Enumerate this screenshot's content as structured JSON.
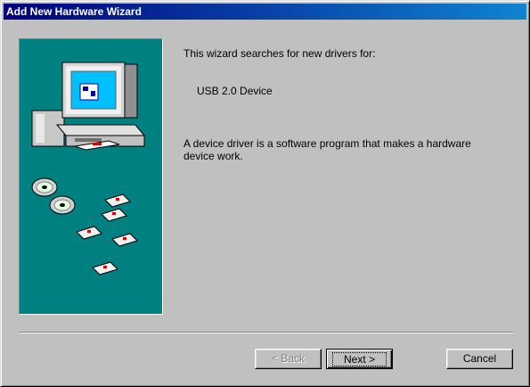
{
  "window": {
    "title": "Add New Hardware Wizard"
  },
  "content": {
    "intro": "This wizard searches for new drivers for:",
    "device": "USB 2.0 Device",
    "description": "A device driver is a software program that makes a hardware device work."
  },
  "buttons": {
    "back": "< Back",
    "next": "Next >",
    "cancel": "Cancel"
  },
  "colors": {
    "title_start": "#00007b",
    "title_end": "#1084d0",
    "panel": "#008080",
    "face": "#c0c0c0"
  },
  "icons": [
    "computer-illustration",
    "cd-icon",
    "floppy-disk-icon"
  ]
}
